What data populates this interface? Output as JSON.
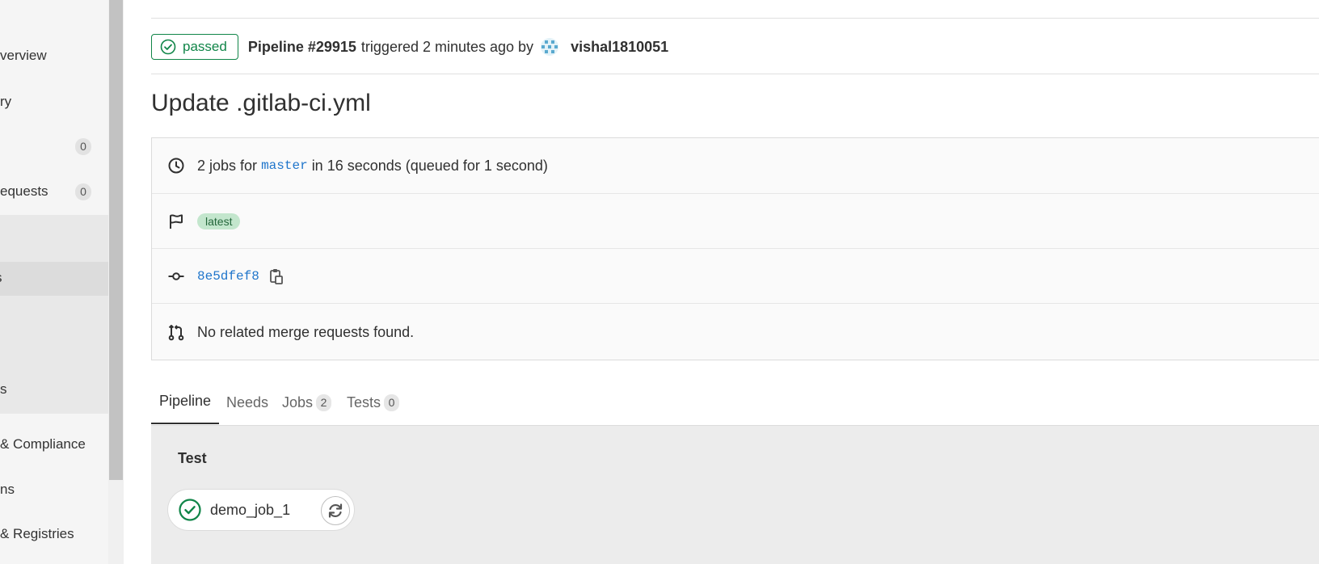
{
  "sidebar": {
    "items": [
      {
        "label": "verview",
        "count": null
      },
      {
        "label": "ry",
        "count": null
      },
      {
        "label": "",
        "count": "0"
      },
      {
        "label": "equests",
        "count": "0"
      },
      {
        "label": "",
        "count": null
      },
      {
        "label": "s",
        "count": null
      },
      {
        "label": "",
        "count": null
      },
      {
        "label": "s",
        "count": null
      },
      {
        "label": "& Compliance",
        "count": null
      },
      {
        "label": "ns",
        "count": null
      },
      {
        "label": "& Registries",
        "count": null
      }
    ]
  },
  "pipeline_header": {
    "status": "passed",
    "pipeline_id": "Pipeline #29915",
    "triggered_text": "triggered 2 minutes ago by",
    "user": "vishal1810051"
  },
  "commit_title": "Update .gitlab-ci.yml",
  "info": {
    "jobs_prefix": "2 jobs for",
    "branch": "master",
    "jobs_suffix": "in 16 seconds (queued for 1 second)",
    "tag": "latest",
    "sha": "8e5dfef8",
    "merge_requests": "No related merge requests found."
  },
  "tabs": [
    {
      "label": "Pipeline",
      "count": null
    },
    {
      "label": "Needs",
      "count": null
    },
    {
      "label": "Jobs",
      "count": "2"
    },
    {
      "label": "Tests",
      "count": "0"
    }
  ],
  "graph": {
    "stage": "Test",
    "job": "demo_job_1"
  },
  "colors": {
    "success": "#108548",
    "link": "#1f75cb"
  }
}
